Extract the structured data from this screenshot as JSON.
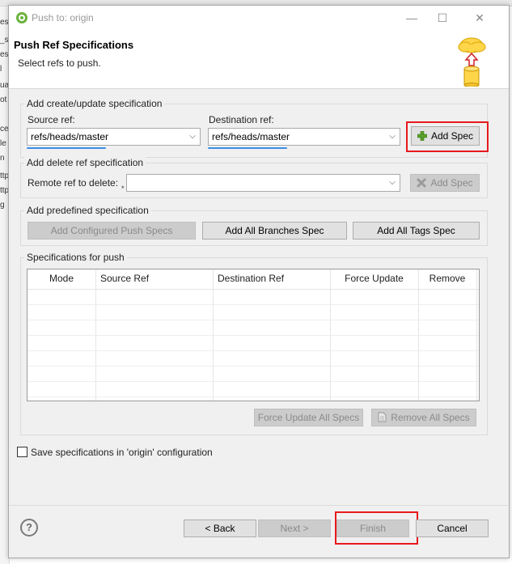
{
  "background": {
    "fragments": [
      "es",
      "_s",
      "es",
      "l",
      "ua",
      "ot",
      "ce",
      "le",
      "n",
      "ttp",
      "ttp",
      "g"
    ]
  },
  "window": {
    "title": "Push to: origin",
    "minimize_glyph": "—",
    "maximize_glyph": "☐",
    "close_glyph": "✕"
  },
  "header": {
    "title": "Push Ref Specifications",
    "description": "Select refs to push."
  },
  "create_group": {
    "label": "Add create/update specification",
    "source_label": "Source ref:",
    "source_value": "refs/heads/master",
    "destination_label": "Destination ref:",
    "destination_value": "refs/heads/master",
    "add_button": "Add Spec"
  },
  "delete_group": {
    "label": "Add delete ref specification",
    "remote_label": "Remote ref to delete:",
    "remote_value": "",
    "add_button": "Add Spec"
  },
  "predefined_group": {
    "label": "Add predefined specification",
    "configured_button": "Add Configured Push Specs",
    "branches_button": "Add All Branches Spec",
    "tags_button": "Add All Tags Spec"
  },
  "specs_group": {
    "label": "Specifications for push",
    "columns": [
      "Mode",
      "Source Ref",
      "Destination Ref",
      "Force Update",
      "Remove"
    ],
    "force_update_all_button": "Force Update All Specs",
    "remove_all_button": "Remove All Specs"
  },
  "save_checkbox": {
    "label": "Save specifications in 'origin' configuration",
    "checked": false
  },
  "footer": {
    "help_glyph": "?",
    "back_button": "< Back",
    "next_button": "Next >",
    "finish_button": "Finish",
    "cancel_button": "Cancel"
  },
  "colors": {
    "highlight": "#e8191e",
    "underline": "#3a8ee6",
    "spring_green": "#6db33f"
  }
}
